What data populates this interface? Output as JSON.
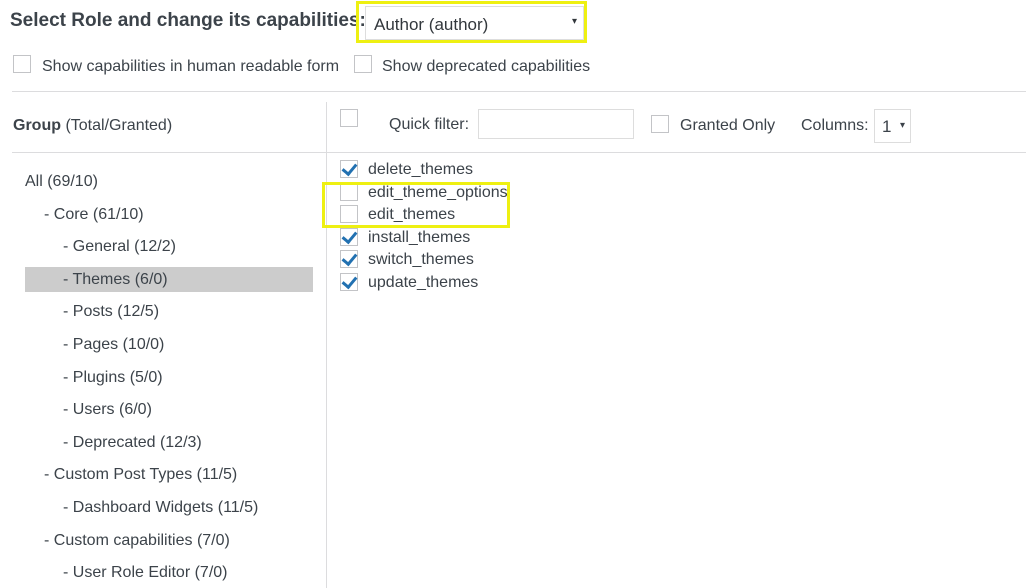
{
  "header": {
    "title": "Select Role and change its capabilities:",
    "role_select": {
      "value": "Author (author)",
      "arrow": "▾"
    }
  },
  "options": {
    "human_readable": {
      "label": "Show capabilities in human readable form",
      "checked": false
    },
    "show_deprecated": {
      "label": "Show deprecated capabilities",
      "checked": false
    }
  },
  "groups": {
    "header_bold": "Group",
    "header_rest": " (Total/Granted)",
    "items": [
      {
        "label": "All (69/10)",
        "level": 0,
        "selected": false
      },
      {
        "label": "- Core (61/10)",
        "level": 1,
        "selected": false
      },
      {
        "label": "- General (12/2)",
        "level": 2,
        "selected": false
      },
      {
        "label": "- Themes (6/0)",
        "level": 2,
        "selected": true
      },
      {
        "label": "- Posts (12/5)",
        "level": 2,
        "selected": false
      },
      {
        "label": "- Pages (10/0)",
        "level": 2,
        "selected": false
      },
      {
        "label": "- Plugins (5/0)",
        "level": 2,
        "selected": false
      },
      {
        "label": "- Users (6/0)",
        "level": 2,
        "selected": false
      },
      {
        "label": "- Deprecated (12/3)",
        "level": 2,
        "selected": false
      },
      {
        "label": "- Custom Post Types (11/5)",
        "level": 1,
        "selected": false
      },
      {
        "label": "- Dashboard Widgets (11/5)",
        "level": 2,
        "selected": false
      },
      {
        "label": "- Custom capabilities (7/0)",
        "level": 1,
        "selected": false
      },
      {
        "label": "- User Role Editor (7/0)",
        "level": 2,
        "selected": false
      }
    ]
  },
  "toolbar": {
    "quick_filter_label": "Quick filter:",
    "quick_filter_value": "",
    "granted_only_label": "Granted Only",
    "columns_label": "Columns:",
    "columns_value": "1",
    "columns_arrow": "▾"
  },
  "capabilities": [
    {
      "name": "delete_themes",
      "granted": true
    },
    {
      "name": "edit_theme_options",
      "granted": false
    },
    {
      "name": "edit_themes",
      "granted": false
    },
    {
      "name": "install_themes",
      "granted": true
    },
    {
      "name": "switch_themes",
      "granted": true
    },
    {
      "name": "update_themes",
      "granted": true
    }
  ],
  "colors": {
    "highlight": "#eef011",
    "check": "#2271b1",
    "selected_group": "#cccccc"
  }
}
